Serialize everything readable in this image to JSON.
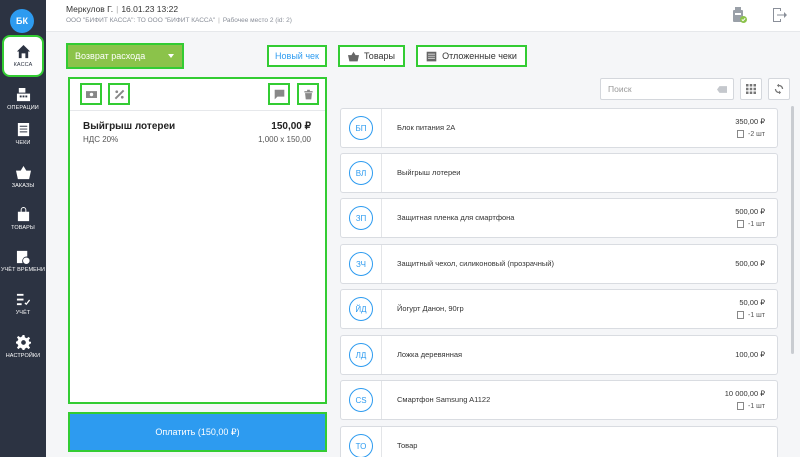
{
  "sidebar": {
    "avatar": "БК",
    "items": [
      {
        "label": "КАССА",
        "icon": "home-icon",
        "active": true
      },
      {
        "label": "ОПЕРАЦИИ",
        "icon": "cash-register-icon"
      },
      {
        "label": "ЧЕКИ",
        "icon": "receipt-icon"
      },
      {
        "label": "ЗАКАЗЫ",
        "icon": "basket-icon"
      },
      {
        "label": "ТОВАРЫ",
        "icon": "bag-icon"
      },
      {
        "label": "УЧЁТ ВРЕМЕНИ",
        "icon": "calendar-clock-icon"
      },
      {
        "label": "УЧЁТ",
        "icon": "checklist-icon"
      },
      {
        "label": "НАСТРОЙКИ",
        "icon": "gear-icon"
      }
    ]
  },
  "header": {
    "user": "Меркулов Г.",
    "datetime": "16.01.23 13:22",
    "org": "ООО \"БИФИТ КАССА\": ТО ООО \"БИФИТ КАССА\"",
    "workplace": "Рабочее место 2 (id: 2)"
  },
  "toolbar": {
    "operation_type": "Возврат расхода",
    "new_receipt": "Новый чек",
    "goods": "Товары",
    "deferred": "Отложенные чеки"
  },
  "cart": {
    "item_name": "Выйгрыш лотереи",
    "item_price": "150,00 ₽",
    "vat": "НДС 20%",
    "calc": "1,000 x 150,00"
  },
  "pay_button": "Оплатить (150,00 ₽)",
  "search": {
    "placeholder": "Поиск"
  },
  "products": [
    {
      "abbr": "БП",
      "name": "Блок питания 2А",
      "price": "350,00 ₽",
      "stock": "-2 шт"
    },
    {
      "abbr": "ВЛ",
      "name": "Выйгрыш лотереи",
      "price": "",
      "stock": ""
    },
    {
      "abbr": "ЗП",
      "name": "Защитная пленка для смартфона",
      "price": "500,00 ₽",
      "stock": "-1 шт"
    },
    {
      "abbr": "ЗЧ",
      "name": "Защитный чехол, силиконовый (прозрачный)",
      "price": "500,00 ₽",
      "stock": ""
    },
    {
      "abbr": "ЙД",
      "name": "Йогурт Данон, 90гр",
      "price": "50,00 ₽",
      "stock": "-1 шт"
    },
    {
      "abbr": "ЛД",
      "name": "Ложка деревянная",
      "price": "100,00 ₽",
      "stock": ""
    },
    {
      "abbr": "CS",
      "name": "Смартфон Samsung A1122",
      "price": "10 000,00 ₽",
      "stock": "-1 шт"
    },
    {
      "abbr": "ТО",
      "name": "Товар",
      "price": "",
      "stock": ""
    }
  ]
}
